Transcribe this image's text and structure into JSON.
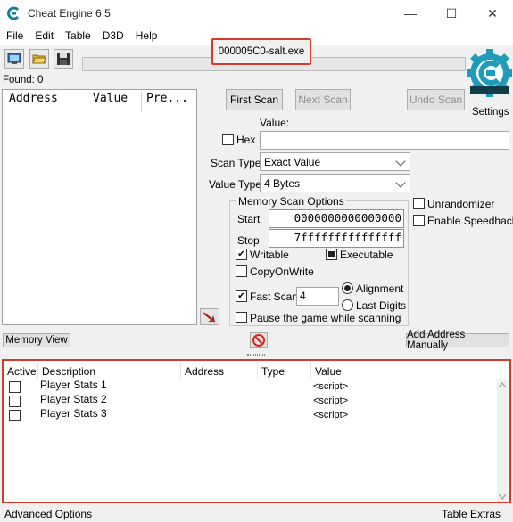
{
  "window": {
    "title": "Cheat Engine 6.5",
    "minimize_glyph": "—",
    "maximize_glyph": "☐",
    "close_glyph": "✕"
  },
  "menu": [
    "File",
    "Edit",
    "Table",
    "D3D",
    "Help"
  ],
  "process": {
    "name": "000005C0-salt.exe"
  },
  "toolbar": {
    "icons": [
      "open-process-icon",
      "open-file-icon",
      "save-icon"
    ]
  },
  "found": "Found: 0",
  "settings_label": "Settings",
  "results_columns": [
    "Address",
    "Value",
    "Pre..."
  ],
  "scan": {
    "first_scan": "First Scan",
    "next_scan": "Next Scan",
    "undo_scan": "Undo Scan",
    "value_label": "Value:",
    "hex_label": "Hex",
    "value_input": "",
    "scan_type_label": "Scan Type",
    "scan_type_value": "Exact Value",
    "value_type_label": "Value Type",
    "value_type_value": "4 Bytes"
  },
  "memory_scan": {
    "title": "Memory Scan Options",
    "start_label": "Start",
    "start_value": "0000000000000000",
    "stop_label": "Stop",
    "stop_value": "7fffffffffffffff",
    "writable": "Writable",
    "executable": "Executable",
    "copy_on_write": "CopyOnWrite",
    "fast_scan": "Fast Scan",
    "fast_scan_value": "4",
    "alignment": "Alignment",
    "last_digits": "Last Digits",
    "pause": "Pause the game while scanning"
  },
  "options": {
    "unrandomizer": "Unrandomizer",
    "speedhack": "Enable Speedhack"
  },
  "bottom_bar": {
    "memory_view": "Memory View",
    "add_address": "Add Address Manually"
  },
  "address_list": {
    "columns": [
      "Active",
      "Description",
      "Address",
      "Type",
      "Value"
    ],
    "rows": [
      {
        "description": "Player Stats 1",
        "value": "<script>"
      },
      {
        "description": "Player Stats 2",
        "value": "<script>"
      },
      {
        "description": "Player Stats 3",
        "value": "<script>"
      }
    ]
  },
  "footer": {
    "advanced_options": "Advanced Options",
    "table_extras": "Table Extras"
  },
  "colors": {
    "highlight_border": "#d63a2a",
    "logo_teal": "#1e9bb8"
  }
}
